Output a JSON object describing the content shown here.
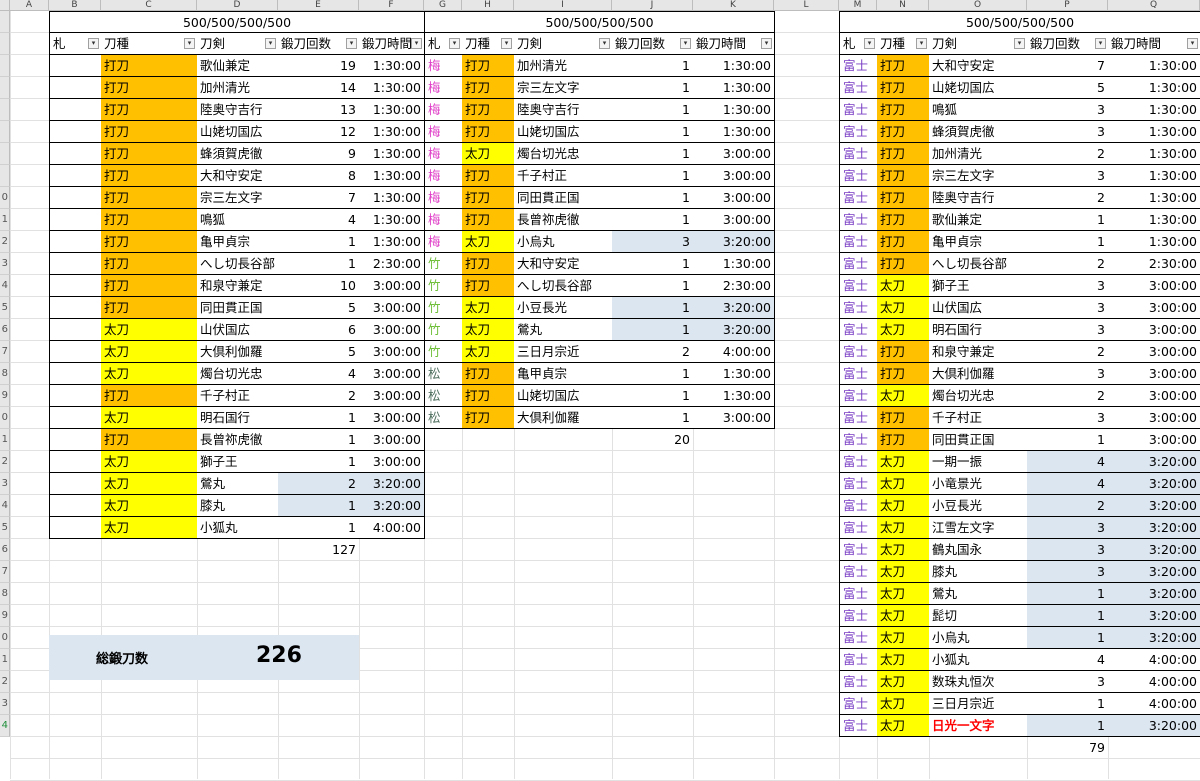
{
  "colors": {
    "uchigatana": "#ffc000",
    "tachi": "#ffff00",
    "highlight": "#dce6f1",
    "ume": "#e040c8",
    "take": "#6fbf3a",
    "matsu": "#507060",
    "fuji": "#7a3ec4",
    "red_text": "#ff0000"
  },
  "sheet": {
    "columns": [
      "A",
      "B",
      "C",
      "D",
      "E",
      "F",
      "G",
      "H",
      "I",
      "J",
      "K",
      "L",
      "M",
      "N",
      "O",
      "P",
      "Q"
    ],
    "row_numbers": [
      "",
      "",
      "",
      "",
      "",
      "",
      "",
      "",
      "0",
      "1",
      "2",
      "3",
      "4",
      "5",
      "6",
      "7",
      "8",
      "9",
      "0",
      "1",
      "2",
      "3",
      "4",
      "5",
      "6",
      "7",
      "8",
      "9",
      "0",
      "1",
      "2",
      "3",
      "4"
    ]
  },
  "tables": [
    {
      "title": "500/500/500/500",
      "headers": [
        "札",
        "刀種",
        "刀剣",
        "鍛刀回数",
        "鍛刀時間"
      ],
      "rows": [
        [
          "",
          "打刀",
          "歌仙兼定",
          "19",
          "1:30:00"
        ],
        [
          "",
          "打刀",
          "加州清光",
          "14",
          "1:30:00"
        ],
        [
          "",
          "打刀",
          "陸奥守吉行",
          "13",
          "1:30:00"
        ],
        [
          "",
          "打刀",
          "山姥切国広",
          "12",
          "1:30:00"
        ],
        [
          "",
          "打刀",
          "蜂須賀虎徹",
          "9",
          "1:30:00"
        ],
        [
          "",
          "打刀",
          "大和守安定",
          "8",
          "1:30:00"
        ],
        [
          "",
          "打刀",
          "宗三左文字",
          "7",
          "1:30:00"
        ],
        [
          "",
          "打刀",
          "鳴狐",
          "4",
          "1:30:00"
        ],
        [
          "",
          "打刀",
          "亀甲貞宗",
          "1",
          "1:30:00"
        ],
        [
          "",
          "打刀",
          "へし切長谷部",
          "1",
          "2:30:00"
        ],
        [
          "",
          "打刀",
          "和泉守兼定",
          "10",
          "3:00:00"
        ],
        [
          "",
          "打刀",
          "同田貫正国",
          "5",
          "3:00:00"
        ],
        [
          "",
          "太刀",
          "山伏国広",
          "6",
          "3:00:00"
        ],
        [
          "",
          "太刀",
          "大倶利伽羅",
          "5",
          "3:00:00"
        ],
        [
          "",
          "太刀",
          "燭台切光忠",
          "4",
          "3:00:00"
        ],
        [
          "",
          "打刀",
          "千子村正",
          "2",
          "3:00:00"
        ],
        [
          "",
          "太刀",
          "明石国行",
          "1",
          "3:00:00"
        ],
        [
          "",
          "打刀",
          "長曾祢虎徹",
          "1",
          "3:00:00"
        ],
        [
          "",
          "太刀",
          "獅子王",
          "1",
          "3:00:00"
        ],
        [
          "",
          "太刀",
          "鶯丸",
          "2",
          "3:20:00"
        ],
        [
          "",
          "太刀",
          "膝丸",
          "1",
          "3:20:00"
        ],
        [
          "",
          "太刀",
          "小狐丸",
          "1",
          "4:00:00"
        ]
      ],
      "kind_override": {
        "13": "打刀",
        "15": "太刀",
        "17": "打刀"
      },
      "highlight_rows": [
        19,
        20
      ],
      "total": "127"
    },
    {
      "title": "500/500/500/500",
      "headers": [
        "札",
        "刀種",
        "刀剣",
        "鍛刀回数",
        "鍛刀時間"
      ],
      "rows": [
        [
          "梅",
          "打刀",
          "加州清光",
          "1",
          "1:30:00"
        ],
        [
          "梅",
          "打刀",
          "宗三左文字",
          "1",
          "1:30:00"
        ],
        [
          "梅",
          "打刀",
          "陸奥守吉行",
          "1",
          "1:30:00"
        ],
        [
          "梅",
          "打刀",
          "山姥切国広",
          "1",
          "1:30:00"
        ],
        [
          "梅",
          "太刀",
          "燭台切光忠",
          "1",
          "3:00:00"
        ],
        [
          "梅",
          "打刀",
          "千子村正",
          "1",
          "3:00:00"
        ],
        [
          "梅",
          "打刀",
          "同田貫正国",
          "1",
          "3:00:00"
        ],
        [
          "梅",
          "打刀",
          "長曾祢虎徹",
          "1",
          "3:00:00"
        ],
        [
          "梅",
          "太刀",
          "小烏丸",
          "3",
          "3:20:00"
        ],
        [
          "竹",
          "打刀",
          "大和守安定",
          "1",
          "1:30:00"
        ],
        [
          "竹",
          "打刀",
          "へし切長谷部",
          "1",
          "2:30:00"
        ],
        [
          "竹",
          "太刀",
          "小豆長光",
          "1",
          "3:20:00"
        ],
        [
          "竹",
          "太刀",
          "鶯丸",
          "1",
          "3:20:00"
        ],
        [
          "竹",
          "太刀",
          "三日月宗近",
          "2",
          "4:00:00"
        ],
        [
          "松",
          "打刀",
          "亀甲貞宗",
          "1",
          "1:30:00"
        ],
        [
          "松",
          "打刀",
          "山姥切国広",
          "1",
          "1:30:00"
        ],
        [
          "松",
          "打刀",
          "大倶利伽羅",
          "1",
          "3:00:00"
        ]
      ],
      "highlight_rows": [
        8,
        11,
        12
      ],
      "total": "20"
    },
    {
      "title": "500/500/500/500",
      "headers": [
        "札",
        "刀種",
        "刀剣",
        "鍛刀回数",
        "鍛刀時間"
      ],
      "rows": [
        [
          "富士",
          "打刀",
          "大和守安定",
          "7",
          "1:30:00"
        ],
        [
          "富士",
          "打刀",
          "山姥切国広",
          "5",
          "1:30:00"
        ],
        [
          "富士",
          "打刀",
          "鳴狐",
          "3",
          "1:30:00"
        ],
        [
          "富士",
          "打刀",
          "蜂須賀虎徹",
          "3",
          "1:30:00"
        ],
        [
          "富士",
          "打刀",
          "加州清光",
          "2",
          "1:30:00"
        ],
        [
          "富士",
          "打刀",
          "宗三左文字",
          "3",
          "1:30:00"
        ],
        [
          "富士",
          "打刀",
          "陸奥守吉行",
          "2",
          "1:30:00"
        ],
        [
          "富士",
          "打刀",
          "歌仙兼定",
          "1",
          "1:30:00"
        ],
        [
          "富士",
          "打刀",
          "亀甲貞宗",
          "1",
          "1:30:00"
        ],
        [
          "富士",
          "打刀",
          "へし切長谷部",
          "2",
          "2:30:00"
        ],
        [
          "富士",
          "太刀",
          "獅子王",
          "3",
          "3:00:00"
        ],
        [
          "富士",
          "太刀",
          "山伏国広",
          "3",
          "3:00:00"
        ],
        [
          "富士",
          "太刀",
          "明石国行",
          "3",
          "3:00:00"
        ],
        [
          "富士",
          "打刀",
          "和泉守兼定",
          "2",
          "3:00:00"
        ],
        [
          "富士",
          "打刀",
          "大倶利伽羅",
          "3",
          "3:00:00"
        ],
        [
          "富士",
          "太刀",
          "燭台切光忠",
          "2",
          "3:00:00"
        ],
        [
          "富士",
          "打刀",
          "千子村正",
          "3",
          "3:00:00"
        ],
        [
          "富士",
          "打刀",
          "同田貫正国",
          "1",
          "3:00:00"
        ],
        [
          "富士",
          "太刀",
          "一期一振",
          "4",
          "3:20:00"
        ],
        [
          "富士",
          "太刀",
          "小竜景光",
          "4",
          "3:20:00"
        ],
        [
          "富士",
          "太刀",
          "小豆長光",
          "2",
          "3:20:00"
        ],
        [
          "富士",
          "太刀",
          "江雪左文字",
          "3",
          "3:20:00"
        ],
        [
          "富士",
          "太刀",
          "鶴丸国永",
          "3",
          "3:20:00"
        ],
        [
          "富士",
          "太刀",
          "膝丸",
          "3",
          "3:20:00"
        ],
        [
          "富士",
          "太刀",
          "鶯丸",
          "1",
          "3:20:00"
        ],
        [
          "富士",
          "太刀",
          "髭切",
          "1",
          "3:20:00"
        ],
        [
          "富士",
          "太刀",
          "小烏丸",
          "1",
          "3:20:00"
        ],
        [
          "富士",
          "太刀",
          "小狐丸",
          "4",
          "4:00:00"
        ],
        [
          "富士",
          "太刀",
          "数珠丸恒次",
          "3",
          "4:00:00"
        ],
        [
          "富士",
          "太刀",
          "三日月宗近",
          "1",
          "4:00:00"
        ],
        [
          "富士",
          "太刀",
          "日光一文字",
          "1",
          "3:20:00"
        ]
      ],
      "highlight_rows": [
        18,
        19,
        20,
        21,
        22,
        23,
        24,
        25,
        26,
        30
      ],
      "red_rows": [
        30
      ],
      "total": "79"
    }
  ],
  "summary": {
    "label": "総鍛刀数",
    "value": "226"
  }
}
